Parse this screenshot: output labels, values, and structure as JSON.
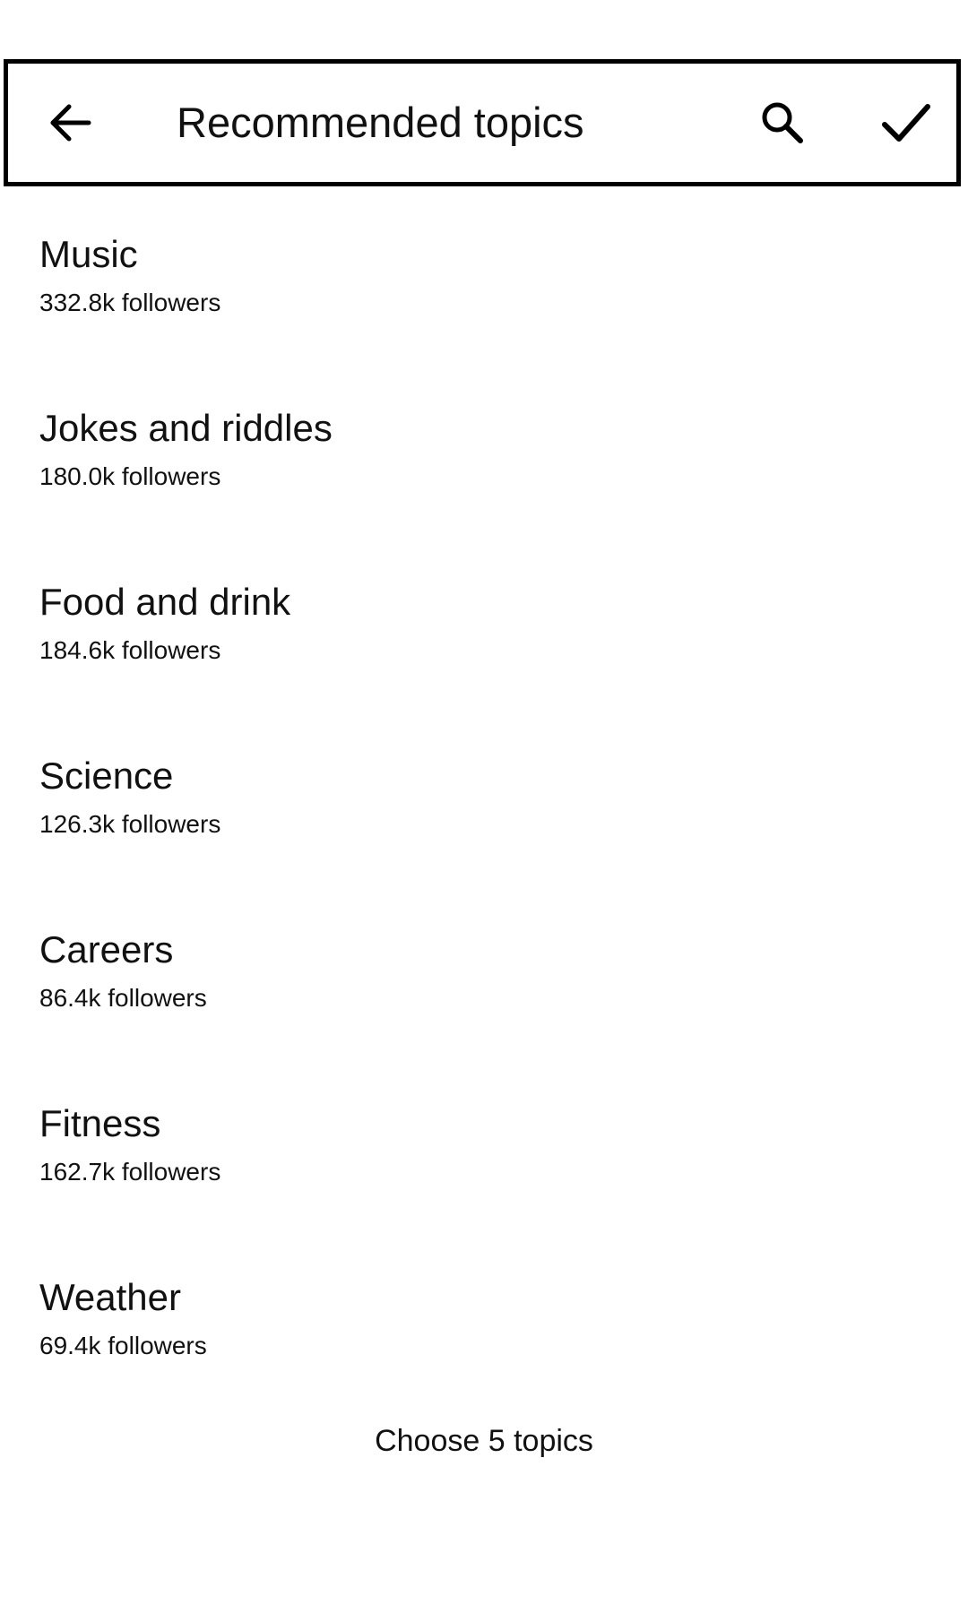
{
  "app_bar": {
    "title": "Recommended topics",
    "back_icon": "arrow-left-icon",
    "search_icon": "search-icon",
    "confirm_icon": "checkmark-icon"
  },
  "topics": [
    {
      "name": "Music",
      "followers": "332.8k followers"
    },
    {
      "name": "Jokes and riddles",
      "followers": "180.0k followers"
    },
    {
      "name": "Food and drink",
      "followers": "184.6k followers"
    },
    {
      "name": "Science",
      "followers": "126.3k followers"
    },
    {
      "name": "Careers",
      "followers": "86.4k followers"
    },
    {
      "name": "Fitness",
      "followers": "162.7k followers"
    },
    {
      "name": "Weather",
      "followers": "69.4k followers"
    }
  ],
  "footer": {
    "hint": "Choose 5 topics"
  }
}
